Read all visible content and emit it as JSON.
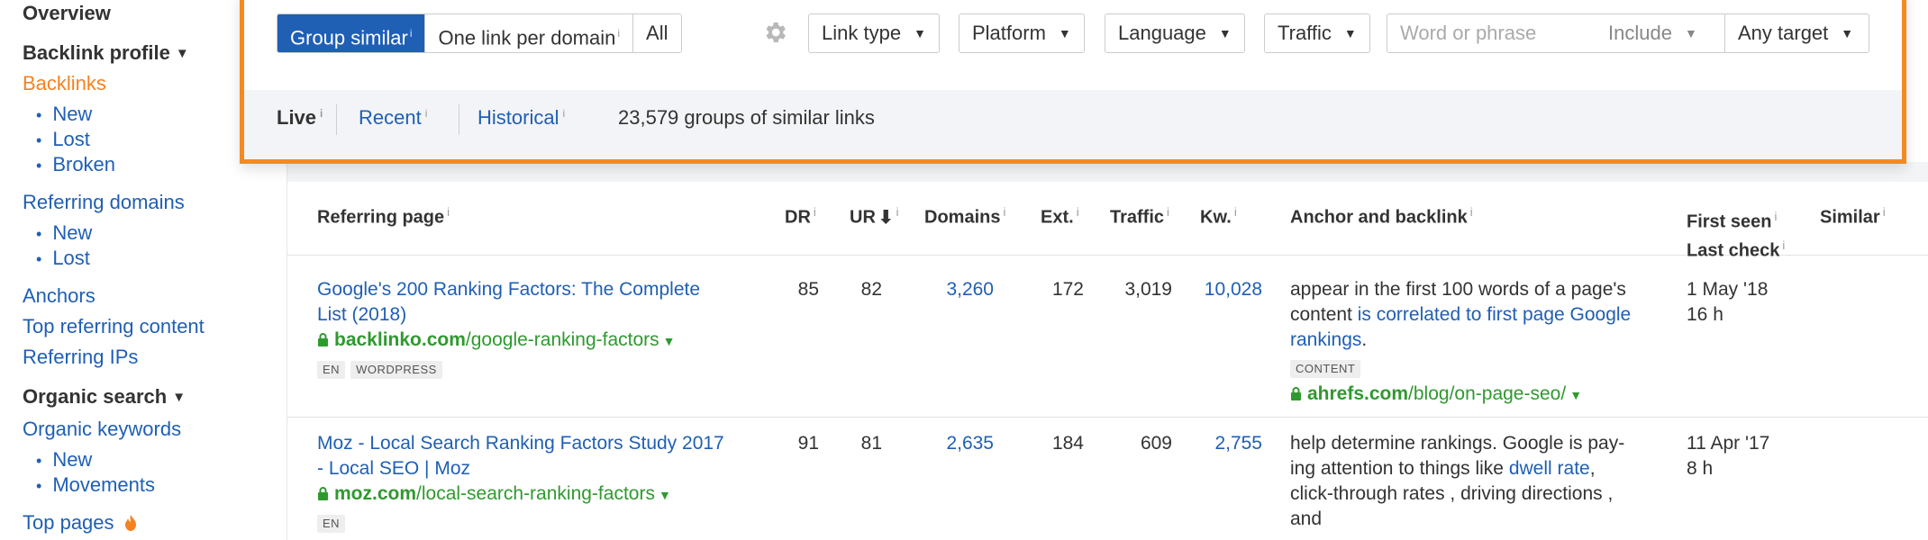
{
  "sidebar": {
    "overview": "Overview",
    "backlink_profile": "Backlink profile",
    "backlinks": "Backlinks",
    "backlink_sub": [
      "New",
      "Lost",
      "Broken"
    ],
    "referring_domains": "Referring domains",
    "domain_sub": [
      "New",
      "Lost"
    ],
    "anchors": "Anchors",
    "top_referring_content": "Top referring content",
    "referring_ips": "Referring IPs",
    "organic_search": "Organic search",
    "organic_keywords": "Organic keywords",
    "keyword_sub": [
      "New",
      "Movements"
    ],
    "top_pages": "Top pages"
  },
  "filters": {
    "group_similar": "Group similar",
    "one_link_per_domain": "One link per domain",
    "all": "All",
    "link_type": "Link type",
    "platform": "Platform",
    "language": "Language",
    "traffic": "Traffic",
    "word_placeholder": "Word or phrase",
    "include": "Include",
    "any_target": "Any target",
    "info": "i"
  },
  "modes": {
    "live": "Live",
    "recent": "Recent",
    "historical": "Historical",
    "count_text": "23,579 groups of similar links"
  },
  "table": {
    "headers": {
      "referring_page": "Referring page",
      "dr": "DR",
      "ur": "UR",
      "domains": "Domains",
      "ext": "Ext.",
      "traffic": "Traffic",
      "kw": "Kw.",
      "anchor": "Anchor and backlink",
      "first_seen": "First seen",
      "last_check": "Last check",
      "similar": "Similar"
    },
    "rows": [
      {
        "title_line1": "Google's 200 Ranking Factors: The Complete",
        "title_line2": "List (2018)",
        "domain": "backlinko.com",
        "path": "/google-ranking-factors",
        "tags": [
          "EN",
          "WORDPRESS"
        ],
        "dr": "85",
        "ur": "82",
        "domains": "3,260",
        "ext": "172",
        "traffic": "3,019",
        "kw": "10,028",
        "anchor_line1": "appear in the first 100 words of a page's",
        "anchor_line2_plain": "content ",
        "anchor_line2_link": "is correlated to first page Google",
        "anchor_line3_link": "rankings",
        "anchor_line3_plain": ".",
        "anchor_tag": "CONTENT",
        "target_domain": "ahrefs.com",
        "target_path": "/blog/on-page-seo/",
        "first_seen": "1 May '18",
        "last_check": "16 h"
      },
      {
        "title_line1": "Moz - Local Search Ranking Factors Study 2017",
        "title_line2": "- Local SEO | Moz",
        "domain": "moz.com",
        "path": "/local-search-ranking-factors",
        "tags": [
          "EN"
        ],
        "dr": "91",
        "ur": "81",
        "domains": "2,635",
        "ext": "184",
        "traffic": "609",
        "kw": "2,755",
        "anchor_line1": "help determine rankings. Google is pay-",
        "anchor_line2_plain": "ing attention to things like ",
        "anchor_line2_link": "dwell rate",
        "anchor_line2_after": ",",
        "anchor_line3": "click-through rates , driving directions ,",
        "anchor_line4": "and",
        "first_seen": "11 Apr '17",
        "last_check": "8 h"
      }
    ]
  },
  "colors": {
    "accent_orange": "#f58a1f",
    "link_blue": "#1f5fb4",
    "domain_green": "#2e9a2e"
  },
  "icons": [
    "caret-down-icon",
    "gear-icon",
    "lock-icon",
    "fire-icon",
    "sort-down-icon"
  ]
}
